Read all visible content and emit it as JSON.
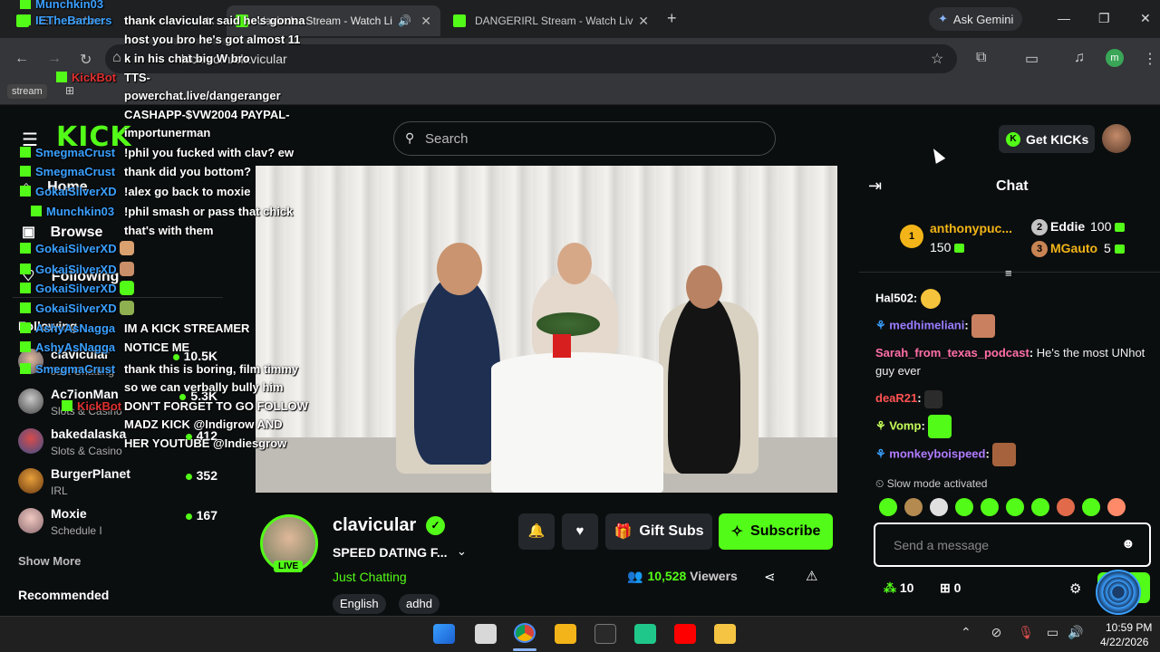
{
  "browser": {
    "tabs": [
      {
        "label": "IETheBarbers"
      },
      {
        "label": "clavicular Stream - Watch Li"
      },
      {
        "label": "DANGERIRL Stream - Watch Liv"
      }
    ],
    "gemini_label": "Ask Gemini",
    "url": "kick.com/clavicular",
    "profile_initial": "m",
    "bookmark_stream": "stream"
  },
  "kick": {
    "logo": "KICK",
    "search_placeholder": "Search",
    "get_kicks_label": "Get KICKs"
  },
  "sidebar": {
    "nav": [
      {
        "label": "Home"
      },
      {
        "label": "Browse"
      },
      {
        "label": "Following"
      }
    ],
    "following_header": "Following",
    "streamers": [
      {
        "name": "clavicular",
        "category": "Just Chatting",
        "viewers": "10.5K"
      },
      {
        "name": "Ac7ionMan",
        "category": "Slots & Casino",
        "viewers": "5.3K"
      },
      {
        "name": "bakedalaska",
        "category": "Slots & Casino",
        "viewers": "412"
      },
      {
        "name": "BurgerPlanet",
        "category": "IRL",
        "viewers": "352"
      },
      {
        "name": "Moxie",
        "category": "Schedule I",
        "viewers": "167"
      }
    ],
    "show_more": "Show More",
    "recommended": "Recommended"
  },
  "overlay": {
    "left_names": [
      "Munchkin03",
      "IETheBarbers",
      "KickBot",
      "SmegmaCrust",
      "SmegmaCrust",
      "GokaiSilverXD",
      "Munchkin03",
      "GokaiSilverXD",
      "GokaiSilverXD",
      "GokaiSilverXD",
      "GokaiSilverXD",
      "AshyAsNagga",
      "AshyAsNagga",
      "SmegmaCrust",
      "KickBot"
    ],
    "messages": [
      "thank clavicular said he's gonna",
      "host you bro he's got almost 11",
      "k in his chat big W bro",
      "TTS-",
      "powerchat.live/dangeranger",
      "CASHAPP-$VW2004 PAYPAL-",
      "importunerman",
      "!phil you fucked with clav? ew",
      "thank did you bottom?",
      "!alex go back to moxie",
      "!phil smash or pass that chick",
      "that's with them",
      "IM A KICK STREAMER",
      "NOTICE ME",
      "thank this is boring, film timmy",
      "so we can verbally bully him",
      "DON'T FORGET TO GO FOLLOW",
      "MADZ KICK @Indigrow AND",
      "HER YOUTUBE @Indiesgrow"
    ]
  },
  "channel": {
    "name": "clavicular",
    "title": "SPEED DATING F...",
    "category": "Just Chatting",
    "live_badge": "LIVE",
    "tags": [
      "English",
      "adhd"
    ],
    "gift_subs_label": "Gift Subs",
    "subscribe_label": "Subscribe",
    "viewers": "10,528",
    "viewers_label": "Viewers"
  },
  "chat": {
    "title": "Chat",
    "leaderboard": [
      {
        "rank": "1",
        "name": "anthonypuc...",
        "amount": "150"
      },
      {
        "rank": "2",
        "name": "Eddie",
        "amount": "100"
      },
      {
        "rank": "3",
        "name": "MGauto",
        "amount": "5"
      }
    ],
    "messages": [
      {
        "user": "Hal502",
        "text": "",
        "color": "#ffffff"
      },
      {
        "user": "medhimeliani",
        "text": "",
        "color": "#9a7cff"
      },
      {
        "user": "Sarah_from_texas_podcast",
        "text": "He's the most UNhot guy ever",
        "color": "#ff6fa8"
      },
      {
        "user": "deaR21",
        "text": "",
        "color": "#ff5252"
      },
      {
        "user": "Vomp",
        "text": "",
        "color": "#c6ff5a"
      },
      {
        "user": "monkeyboispeed",
        "text": "",
        "color": "#b07cff"
      }
    ],
    "slow_mode": "Slow mode activated",
    "input_placeholder": "Send a message",
    "kicks_count": "10",
    "gift_count": "0"
  },
  "taskbar": {
    "time": "10:59 PM",
    "date": "4/22/2026"
  },
  "colors": {
    "kick_green": "#53fc18",
    "background": "#0b0e0f",
    "surface": "#24272c"
  }
}
